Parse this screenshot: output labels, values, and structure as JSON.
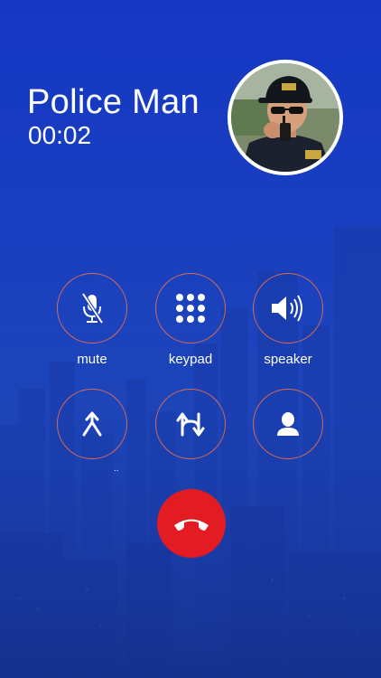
{
  "call": {
    "name": "Police Man",
    "timer": "00:02",
    "avatar_icon": "police-officer-photo"
  },
  "controls": [
    {
      "label": "mute",
      "icon": "mute-mic-icon"
    },
    {
      "label": "keypad",
      "icon": "keypad-icon"
    },
    {
      "label": "speaker",
      "icon": "speaker-icon"
    },
    {
      "label": "",
      "icon": "merge-call-icon"
    },
    {
      "label": "",
      "icon": "swap-call-icon"
    },
    {
      "label": "",
      "icon": "contacts-icon"
    }
  ],
  "merge_dots": "..",
  "end_call": {
    "icon": "end-call-icon"
  },
  "colors": {
    "background": "#1a3fc0",
    "ring": "#d96a52",
    "end_call": "#e31b23",
    "text": "#ffffff"
  }
}
